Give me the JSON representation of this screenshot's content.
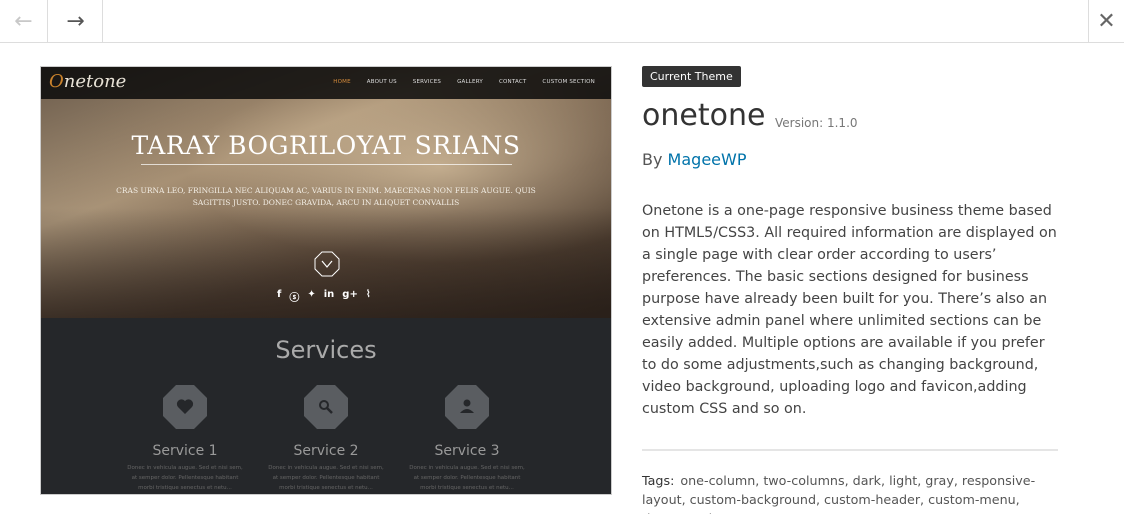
{
  "nav": {
    "prev_icon": "arrow-left-icon",
    "next_icon": "arrow-right-icon",
    "close_icon": "close-icon"
  },
  "preview": {
    "logo": "Onetone",
    "menu": [
      "HOME",
      "ABOUT US",
      "SERVICES",
      "GALLERY",
      "CONTACT",
      "CUSTOM SECTION"
    ],
    "hero_title": "TARAY BOGRILOYAT SRIANS",
    "hero_subtitle": "CRAS URNA LEO, FRINGILLA NEC ALIQUAM AC, VARIUS IN ENIM. MAECENAS NON FELIS AUGUE. QUIS SAGITTIS JUSTO. DONEC GRAVIDA, ARCU IN ALIQUET CONVALLIS",
    "social_icons": [
      "facebook-icon",
      "skype-icon",
      "twitter-icon",
      "linkedin-icon",
      "google-plus-icon",
      "rss-icon"
    ],
    "services_title": "Services",
    "services": [
      {
        "name": "Service 1",
        "icon": "heart-icon",
        "text": "Donec in vehicula augue. Sed et nisi sem, at semper dolor. Pellentesque habitant morbi tristique senectus et netu..."
      },
      {
        "name": "Service 2",
        "icon": "search-icon",
        "text": "Donec in vehicula augue. Sed et nisi sem, at semper dolor. Pellentesque habitant morbi tristique senectus et netu..."
      },
      {
        "name": "Service 3",
        "icon": "user-icon",
        "text": "Donec in vehicula augue. Sed et nisi sem, at semper dolor. Pellentesque habitant morbi tristique senectus et netu..."
      }
    ]
  },
  "theme": {
    "badge": "Current Theme",
    "name": "onetone",
    "version": "Version: 1.1.0",
    "by_label": "By",
    "author": "MageeWP",
    "description": "Onetone is a one-page responsive business theme based on HTML5/CSS3. All required information are displayed on a single page with clear order according to users’ preferences. The basic sections designed for business purpose have already been built for you. There’s also an extensive admin panel where unlimited sections can be easily added. Multiple options are available if you prefer to do some adjustments,such as changing background, video background, uploading logo and favicon,adding custom CSS and so on.",
    "tags_label": "Tags:",
    "tags": "one-column, two-columns, dark, light, gray, responsive-layout, custom-background, custom-header, custom-menu, theme-options,"
  },
  "colors": {
    "link": "#0073aa",
    "badge_bg": "#333333",
    "preview_accent": "#d48a3a"
  }
}
